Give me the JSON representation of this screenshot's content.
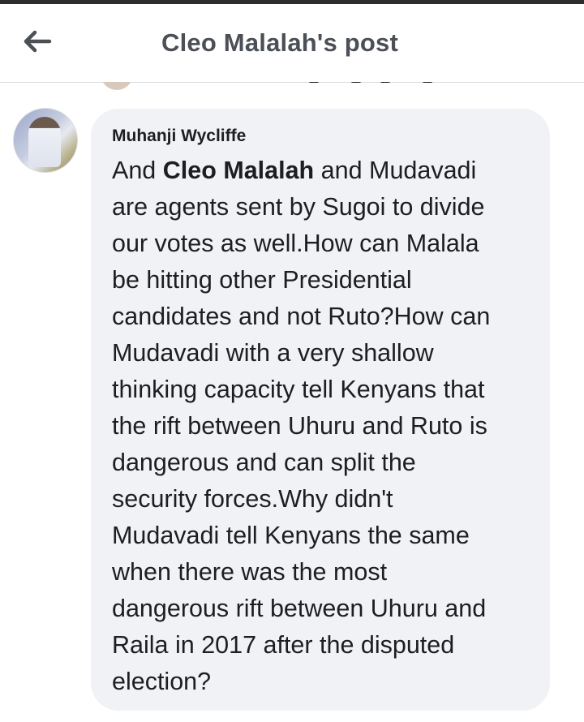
{
  "header": {
    "title": "Cleo Malalah's post",
    "back_icon": "arrow-left-icon"
  },
  "comment": {
    "author": "Muhanji Wycliffe",
    "text_before_mention": "And ",
    "mention": "Cleo Malalah",
    "text_after_mention": " and Mudavadi\nare agents sent by Sugoi to divide\nour votes as well.How can Malala\nbe hitting other Presidential\ncandidates and not Ruto?How can\nMudavadi with a very shallow\nthinking capacity tell Kenyans that\nthe rift between Uhuru and Ruto is\ndangerous and can split the\nsecurity forces.Why didn't\nMudavadi tell Kenyans the same\nwhen there was  the most\ndangerous rift between Uhuru and\nRaila in 2017 after the disputed\nelection?"
  },
  "colors": {
    "title_text": "#4b4f56",
    "body_text": "#1c1e21",
    "bubble_background": "#f0f2f5",
    "divider": "#dadde1"
  }
}
